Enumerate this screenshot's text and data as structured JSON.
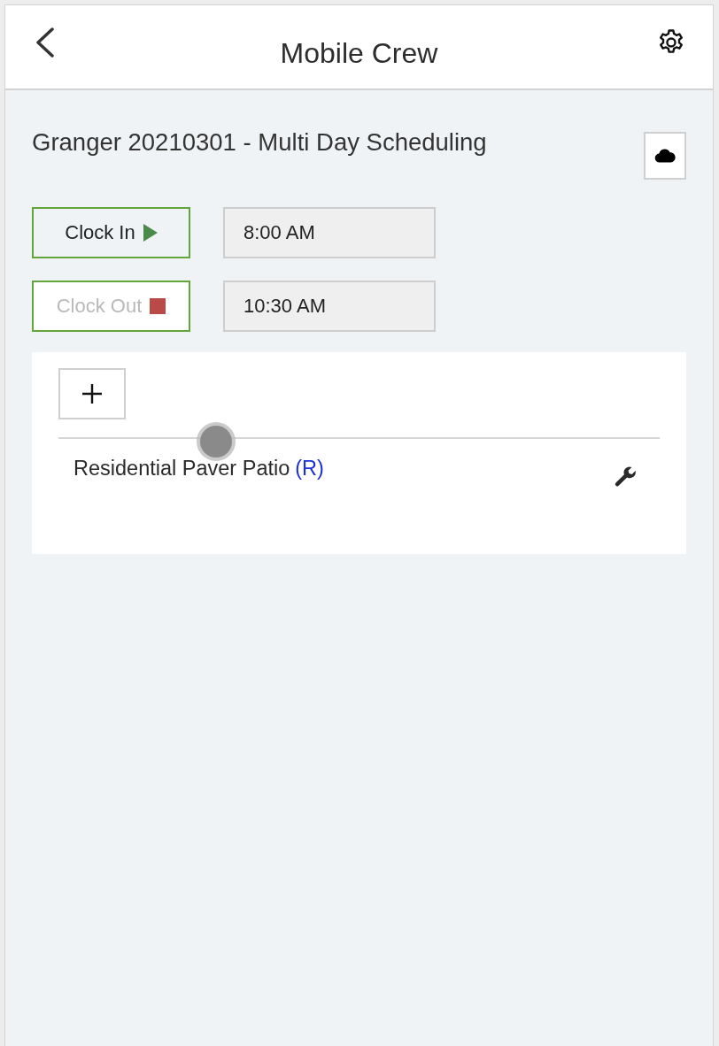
{
  "header": {
    "title": "Mobile Crew"
  },
  "job": {
    "title": "Granger 20210301 - Multi Day Scheduling"
  },
  "clock": [
    {
      "kind": "clock_in",
      "label": "Clock In",
      "disabled": false,
      "time": "8:00 AM"
    },
    {
      "kind": "clock_out",
      "label": "Clock Out",
      "disabled": true,
      "time": "10:30 AM"
    }
  ],
  "services": [
    {
      "name": "Residential Paver Patio",
      "tag": "(R)"
    }
  ]
}
